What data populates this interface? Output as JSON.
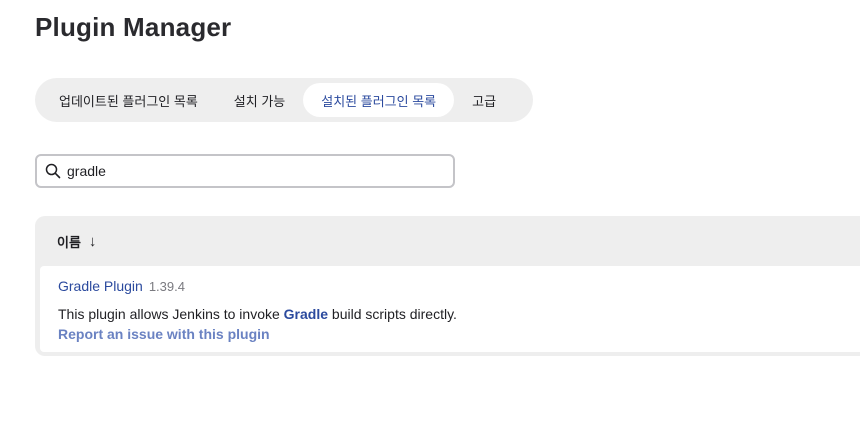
{
  "page": {
    "title": "Plugin Manager"
  },
  "tabs": [
    {
      "label": "업데이트된 플러그인 목록",
      "active": false
    },
    {
      "label": "설치 가능",
      "active": false
    },
    {
      "label": "설치된 플러그인 목록",
      "active": true
    },
    {
      "label": "고급",
      "active": false
    }
  ],
  "search": {
    "value": "gradle",
    "icon": "search-icon"
  },
  "table": {
    "header": {
      "name_label": "이름",
      "sort_indicator": "↓"
    },
    "rows": [
      {
        "name": "Gradle Plugin",
        "version": "1.39.4",
        "description_before": "This plugin allows Jenkins to invoke ",
        "description_link": "Gradle",
        "description_after": " build scripts directly.",
        "report_link": "Report an issue with this plugin"
      }
    ]
  },
  "colors": {
    "accent": "#2b4a9e",
    "link_muted": "#6a82c2",
    "panel": "#eeeeee"
  }
}
